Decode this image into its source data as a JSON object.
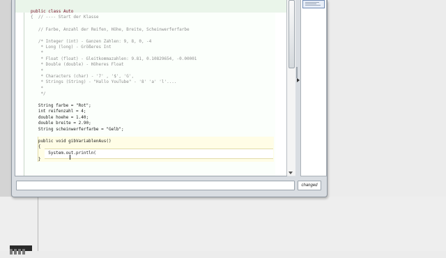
{
  "editor": {
    "lines": [
      {
        "text": "public class Auto",
        "kind": "keyword-line"
      },
      {
        "text": "{  // ---- Start der Klasse",
        "kind": "comment"
      },
      {
        "text": "",
        "kind": "blank"
      },
      {
        "text": "   // Farbe, Anzahl der Reifen, Höhe, Breite, Scheinwerferfarbe",
        "kind": "comment"
      },
      {
        "text": "",
        "kind": "blank"
      },
      {
        "text": "   /* Integer (int) - Ganzen Zahlen: 9, 8, 0, -4",
        "kind": "comment"
      },
      {
        "text": "    * Long (long) - Größeres Int",
        "kind": "comment"
      },
      {
        "text": "    *",
        "kind": "comment"
      },
      {
        "text": "    * Float (float) - Gleitkommazahlen: 9.81, 0.10829654, -0.00001",
        "kind": "comment"
      },
      {
        "text": "    * Double (double) - Höheres Float",
        "kind": "comment"
      },
      {
        "text": "    *",
        "kind": "comment"
      },
      {
        "text": "    * Characters (char) - '7' , '$', 'G',",
        "kind": "comment"
      },
      {
        "text": "    * Strings (String) - \"Hallo YouTube\" - '8' 'a' 'l'....",
        "kind": "comment"
      },
      {
        "text": "    *",
        "kind": "comment"
      },
      {
        "text": "    */",
        "kind": "comment"
      },
      {
        "text": "",
        "kind": "blank"
      },
      {
        "text": "   String farbe = \"Rot\";",
        "kind": "code"
      },
      {
        "text": "   int reifenzahl = 4;",
        "kind": "code"
      },
      {
        "text": "   double hoehe = 1.40;",
        "kind": "code"
      },
      {
        "text": "   double breite = 2.90;",
        "kind": "code"
      },
      {
        "text": "   String scheinwerferfarbe = \"Gelb\";",
        "kind": "code"
      },
      {
        "text": "",
        "kind": "blank"
      },
      {
        "text": "   public void gibVariablenAus()",
        "kind": "code"
      },
      {
        "text": "   {",
        "kind": "code"
      },
      {
        "text": "       System.out.println(",
        "kind": "code"
      },
      {
        "text": "   }",
        "kind": "code"
      }
    ]
  },
  "status": {
    "message": "",
    "changed_label": "changed"
  },
  "colors": {
    "class_band": "#eaf5ea",
    "method_band": "#fffde6",
    "keyword": "#7a0f2a",
    "comment": "#8e8e8e"
  }
}
